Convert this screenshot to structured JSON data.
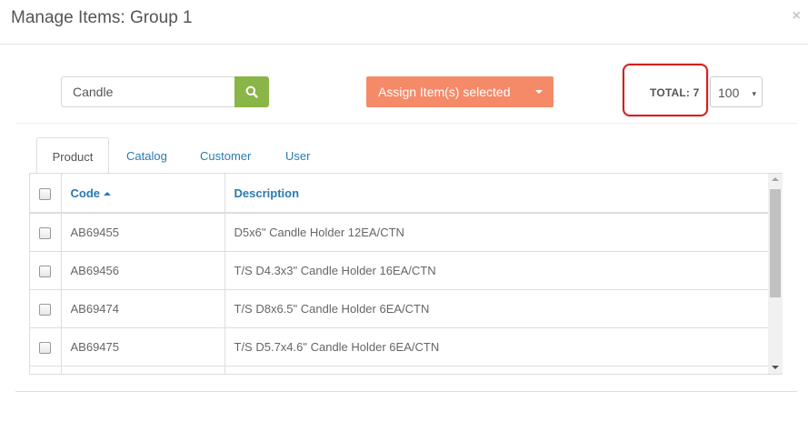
{
  "modal": {
    "title": "Manage Items: Group 1",
    "close_symbol": "×"
  },
  "search": {
    "value": "Candle",
    "button_icon": "search-icon"
  },
  "assign": {
    "label": "Assign Item(s) selected",
    "caret_icon": "caret-down-icon"
  },
  "total": {
    "label": "TOTAL: 7"
  },
  "page_size": {
    "value": "100",
    "caret": "▾"
  },
  "tabs": [
    {
      "label": "Product",
      "active": true
    },
    {
      "label": "Catalog",
      "active": false
    },
    {
      "label": "Customer",
      "active": false
    },
    {
      "label": "User",
      "active": false
    }
  ],
  "table": {
    "columns": {
      "code": "Code",
      "description": "Description"
    },
    "rows": [
      {
        "code": "AB69455",
        "description": "D5x6\" Candle Holder 12EA/CTN"
      },
      {
        "code": "AB69456",
        "description": "T/S D4.3x3\" Candle Holder 16EA/CTN"
      },
      {
        "code": "AB69474",
        "description": "T/S D8x6.5\" Candle Holder 6EA/CTN"
      },
      {
        "code": "AB69475",
        "description": "T/S D5.7x4.6\" Candle Holder 6EA/CTN"
      },
      {
        "code": "",
        "description": ""
      }
    ]
  },
  "colors": {
    "search_button": "#8ab547",
    "assign_button": "#f58a69",
    "link": "#2a7ab0",
    "highlight_box": "#d41f1f"
  }
}
